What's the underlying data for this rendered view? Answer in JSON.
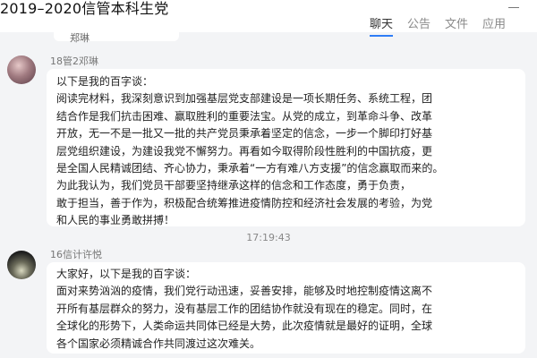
{
  "header": {
    "group_title": "2019–2020信管本科生党",
    "tabs": [
      {
        "label": "聊天",
        "active": true
      },
      {
        "label": "公告",
        "active": false
      },
      {
        "label": "文件",
        "active": false
      },
      {
        "label": "应用",
        "active": false
      }
    ]
  },
  "previous_message": {
    "sender": "郑琳"
  },
  "messages": [
    {
      "sender": "18管2邓琳",
      "lines": [
        "以下是我的百字谈：",
        "阅读完材料，我深刻意识到加强基层党支部建设是一项长期任务、系统工程，团",
        "结合作是我们抗击困难、赢取胜利的重要法宝。从党的成立，到革命斗争、改革",
        "开放，无一不是一批又一批的共产党员秉承着坚定的信念，一步一个脚印打好基",
        "层党组织建设，为建设我党不懈努力。再看如今取得阶段性胜利的中国抗疫，更",
        "是全国人民精诚团结、齐心协力，秉承着“一方有难八方支援”的信念赢取而来的。",
        "为此我认为，我们党员干部要坚持继承这样的信念和工作态度，勇于负责，",
        "敢于担当，善于作为，积极配合统筹推进疫情防控和经济社会发展的考验，为党",
        "和人民的事业勇敢拼搏！"
      ]
    },
    {
      "sender": "16信计许悦",
      "lines": [
        "大家好，以下是我的百字谈：",
        "面对来势汹汹的疫情，我们党行动迅速，妥善安排，能够及时地控制疫情这离不",
        "开所有基层群众的努力，没有基层工作的团结协作就没有现在的稳定。同时，在",
        "全球化的形势下，人类命运共同体已经是大势，此次疫情就是最好的证明，全球",
        "各个国家必须精诚合作共同渡过这次难关。"
      ]
    }
  ],
  "timestamp": "17:19:43"
}
